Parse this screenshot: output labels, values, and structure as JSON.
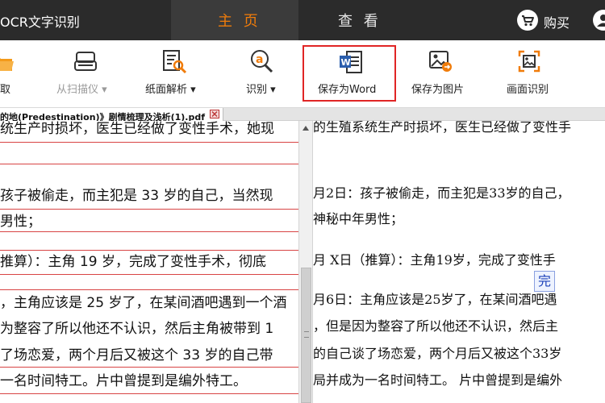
{
  "header": {
    "app_title": "OCR文字识别",
    "tabs": [
      {
        "label": "主 页",
        "active": true
      },
      {
        "label": "查 看",
        "active": false
      }
    ],
    "buy_label": "购买"
  },
  "toolbar": {
    "tools": [
      {
        "label": "取",
        "icon": "open-folder-icon",
        "enabled": true
      },
      {
        "label": "从扫描仪 ▾",
        "icon": "scanner-icon",
        "enabled": false
      },
      {
        "label": "纸面解析 ▾",
        "icon": "page-analysis-icon",
        "enabled": true
      },
      {
        "label": "识别 ▾",
        "icon": "recognize-icon",
        "enabled": true
      },
      {
        "label": "保存为Word",
        "icon": "word-icon",
        "enabled": true
      },
      {
        "label": "保存为图片",
        "icon": "save-image-icon",
        "enabled": true
      },
      {
        "label": "画面识别",
        "icon": "screen-capture-icon",
        "enabled": true
      }
    ]
  },
  "file_tab": {
    "label": "的地(Predestination)》剧情梳理及浅析(1).pdf"
  },
  "left_doc": {
    "lines": [
      "统生产时损坏，医生已经做了变性手术，她现",
      "孩子被偷走，而主犯是 33 岁的自己，当然现",
      "男性；",
      "推算）：主角 19 岁，完成了变性手术，彻底",
      "，主角应该是 25 岁了，在某间酒吧遇到一个酒",
      "为整容了所以他还不认识，然后主角被带到 1",
      "了场恋爱，两个月后又被这个 33 岁的自己带",
      "一名时间特工。片中曾提到是编外特工。"
    ]
  },
  "right_doc": {
    "lines": [
      "的生殖系统生产时损坏，医生已经做了变性手",
      "月2日：孩子被偷走，而主犯是33岁的自己，",
      "神秘中年男性；",
      "月 X日（推算）：主角19岁，完成了变性手",
      "月6日：主角应该是25岁了，在某间酒吧遇",
      "，但是因为整容了所以他还不认识，然后主",
      "的自己谈了场恋爱，两个月后又被这个33岁",
      "局并成为一名时间特工。 片中曾提到是编外"
    ],
    "tooltip_char": "完"
  },
  "colors": {
    "topbar": "#2b2b2b",
    "accent": "#f07c0a",
    "highlight_border": "#e02525",
    "red_rule": "#d84444"
  }
}
